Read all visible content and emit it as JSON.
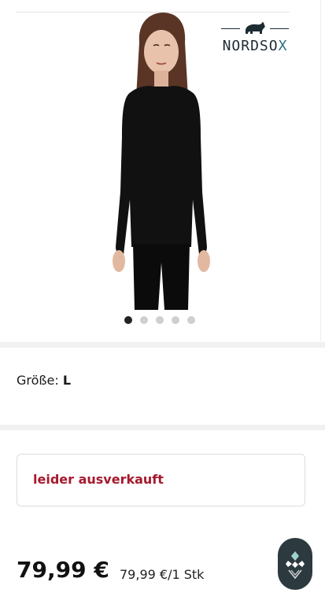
{
  "brand": {
    "name_main": "NORDSO",
    "name_accent": "X",
    "logo_icon": "bear-icon"
  },
  "gallery": {
    "image": "product-photo-longsleeve-black",
    "dot_count": 5,
    "active_index": 0
  },
  "size": {
    "label": "Größe:",
    "value": "L"
  },
  "stock": {
    "status": "leider ausverkauft",
    "status_color": "#a6192e"
  },
  "pricing": {
    "price": "79,99 €",
    "unit_price": "79,99 €/1 Stk"
  },
  "fab": {
    "icon": "brand-emblem-icon"
  }
}
